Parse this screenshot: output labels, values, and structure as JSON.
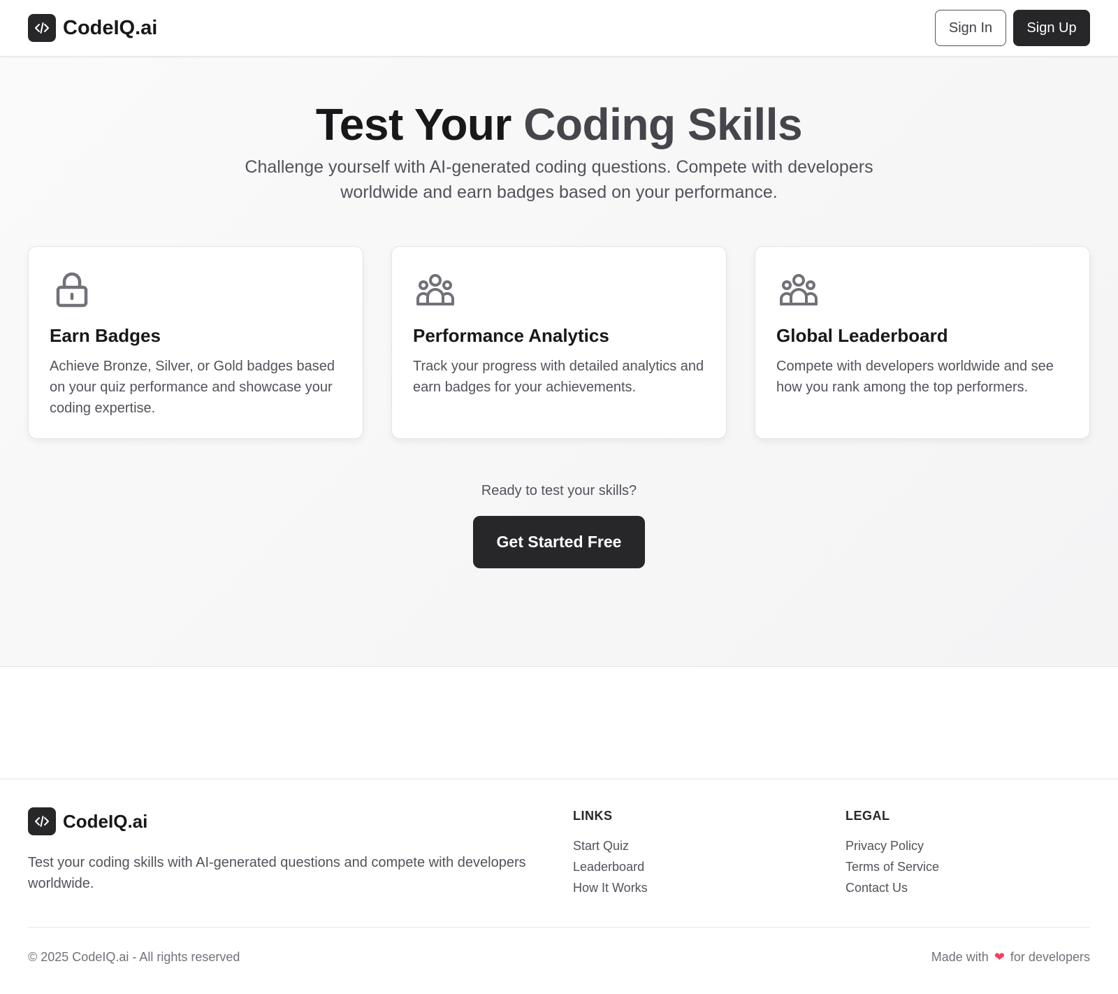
{
  "brand": {
    "name": "CodeIQ.ai",
    "logo_glyph": "</>"
  },
  "header": {
    "signin_label": "Sign In",
    "signup_label": "Sign Up"
  },
  "hero": {
    "title_main": "Test Your ",
    "title_accent": "Coding Skills",
    "subtitle": "Challenge yourself with AI-generated coding questions. Compete with developers worldwide and earn badges based on your performance."
  },
  "features": [
    {
      "icon": "lock-icon",
      "title": "Earn Badges",
      "description": "Achieve Bronze, Silver, or Gold badges based on your quiz performance and showcase your coding expertise."
    },
    {
      "icon": "users-icon",
      "title": "Performance Analytics",
      "description": "Track your progress with detailed analytics and earn badges for your achievements."
    },
    {
      "icon": "users-icon",
      "title": "Global Leaderboard",
      "description": "Compete with developers worldwide and see how you rank among the top performers."
    }
  ],
  "cta": {
    "prompt": "Ready to test your skills?",
    "button_label": "Get Started Free"
  },
  "footer": {
    "description": "Test your coding skills with AI-generated questions and compete with developers worldwide.",
    "links": {
      "title": "LINKS",
      "items": [
        "Start Quiz",
        "Leaderboard",
        "How It Works"
      ]
    },
    "legal": {
      "title": "LEGAL",
      "items": [
        "Privacy Policy",
        "Terms of Service",
        "Contact Us"
      ]
    },
    "copyright": "© 2025 CodeIQ.ai - All rights reserved",
    "made_with_prefix": "Made with",
    "made_with_suffix": "for developers",
    "heart_glyph": "❤"
  },
  "colors": {
    "primary": "#27272a",
    "accent_text": "#45454c",
    "heart": "#f43f5e",
    "icon": "#71717a"
  }
}
